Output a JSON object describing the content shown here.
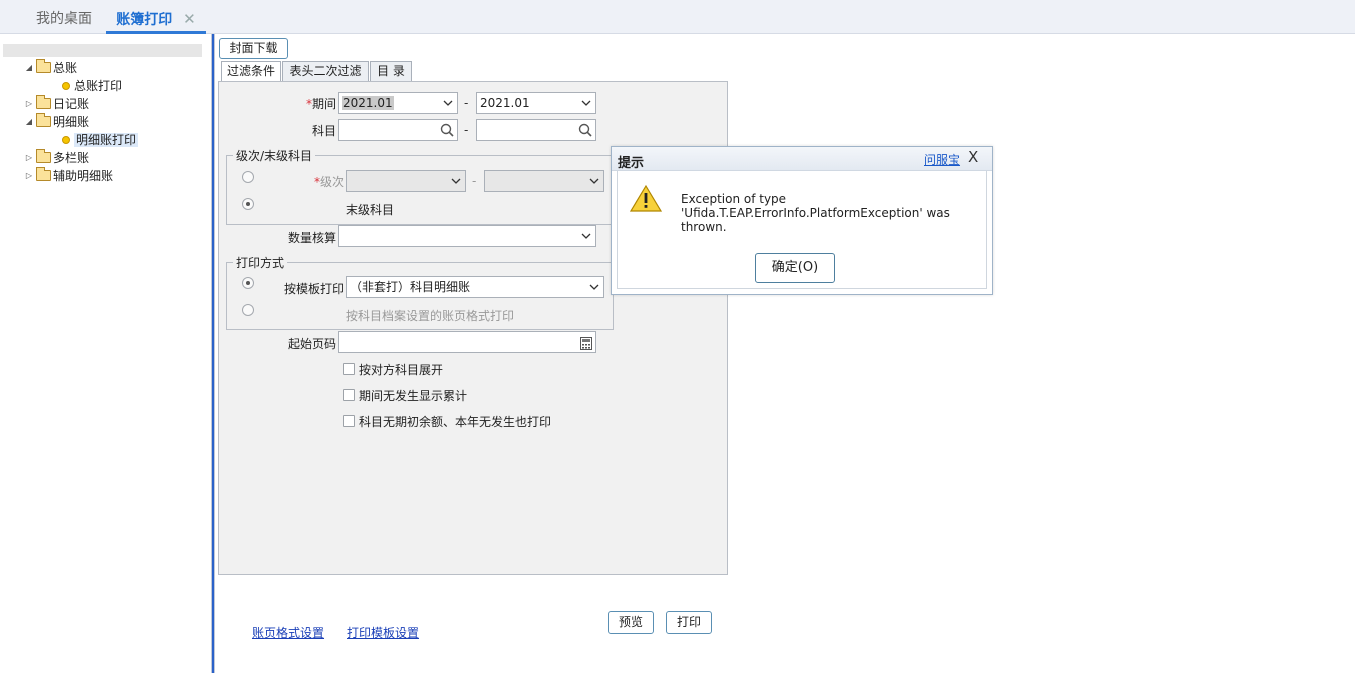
{
  "top_tabs": {
    "desk": "我的桌面",
    "print": "账簿打印",
    "close_glyph": "✕"
  },
  "tree": [
    {
      "label": "总账",
      "toggle": "◢",
      "kind": "folder-open"
    },
    {
      "label": "总账打印",
      "kind": "leaf"
    },
    {
      "label": "日记账",
      "toggle": "▷",
      "kind": "folder"
    },
    {
      "label": "明细账",
      "toggle": "◢",
      "kind": "folder-open"
    },
    {
      "label": "明细账打印",
      "kind": "leaf",
      "selected": true
    },
    {
      "label": "多栏账",
      "toggle": "▷",
      "kind": "folder"
    },
    {
      "label": "辅助明细账",
      "toggle": "▷",
      "kind": "folder"
    }
  ],
  "cover_button": "封面下载",
  "subtabs": [
    "过滤条件",
    "表头二次过滤",
    "目 录"
  ],
  "form": {
    "period": {
      "label": "期间",
      "required_mark": "*",
      "from": "2021.01",
      "to": "2021.01"
    },
    "subject": {
      "label": "科目",
      "from": "",
      "to": ""
    },
    "dash": "-",
    "level_group": {
      "legend": "级次/末级科目",
      "level_label": "级次",
      "level_required_mark": "*",
      "leaf_label": "末级科目",
      "selected": "leaf"
    },
    "quantity": {
      "label": "数量核算",
      "value": ""
    },
    "print_group": {
      "legend": "打印方式",
      "template_label": "按模板打印",
      "template_value": "（非套打）科目明细账",
      "archive_label": "按科目档案设置的账页格式打印",
      "selected": "template"
    },
    "start_page": {
      "label": "起始页码",
      "value": ""
    },
    "checkboxes": [
      {
        "label": "按对方科目展开",
        "checked": false
      },
      {
        "label": "期间无发生显示累计",
        "checked": false
      },
      {
        "label": "科目无期初余额、本年无发生也打印",
        "checked": false
      }
    ]
  },
  "footer": {
    "link_format": "账页格式设置",
    "link_template": "打印模板设置",
    "preview": "预览",
    "print": "打印"
  },
  "dialog": {
    "title": "提示",
    "service_link": "问服宝",
    "close": "X",
    "message": "Exception of type 'Ufida.T.EAP.ErrorInfo.PlatformException' was thrown.",
    "ok": "确定(O)"
  },
  "colors": {
    "accent": "#2f79d6",
    "link": "#1a3fb7",
    "splitter": "#2a62c9",
    "required": "#d8333b"
  }
}
